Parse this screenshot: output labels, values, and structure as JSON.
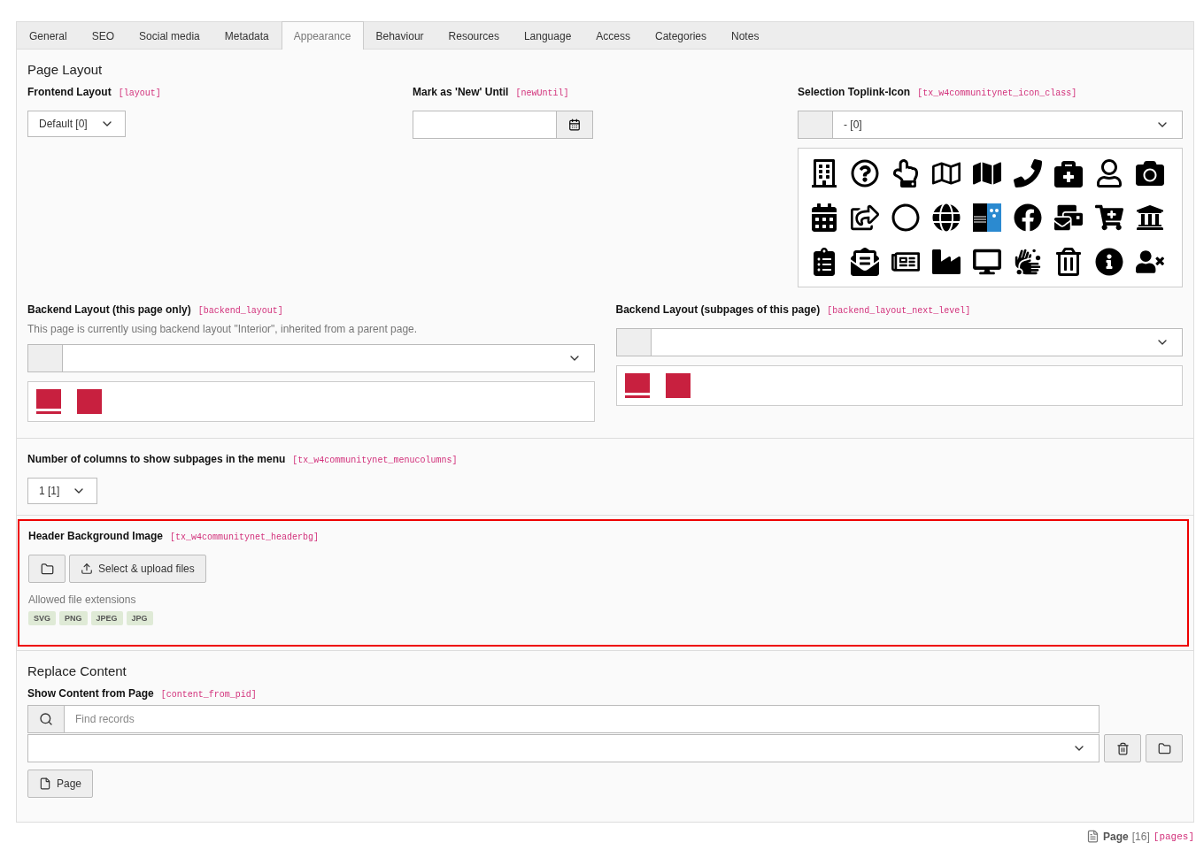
{
  "tabs": [
    {
      "label": "General",
      "selected": false
    },
    {
      "label": "SEO",
      "selected": false
    },
    {
      "label": "Social media",
      "selected": false
    },
    {
      "label": "Metadata",
      "selected": false
    },
    {
      "label": "Appearance",
      "selected": true
    },
    {
      "label": "Behaviour",
      "selected": false
    },
    {
      "label": "Resources",
      "selected": false
    },
    {
      "label": "Language",
      "selected": false
    },
    {
      "label": "Access",
      "selected": false
    },
    {
      "label": "Categories",
      "selected": false
    },
    {
      "label": "Notes",
      "selected": false
    }
  ],
  "page_layout": {
    "title": "Page Layout",
    "frontend_layout": {
      "label": "Frontend Layout",
      "field": "[layout]",
      "value": "Default [0]"
    },
    "new_until": {
      "label": "Mark as 'New' Until",
      "field": "[newUntil]"
    },
    "toplink_icon": {
      "label": "Selection Toplink-Icon",
      "field": "[tx_w4communitynet_icon_class]",
      "value": "- [0]"
    },
    "backend_layout": {
      "label": "Backend Layout (this page only)",
      "field": "[backend_layout]",
      "description": "This page is currently using backend layout \"Interior\", inherited from a parent page."
    },
    "backend_layout_next": {
      "label": "Backend Layout (subpages of this page)",
      "field": "[backend_layout_next_level]"
    }
  },
  "menu_columns": {
    "label": "Number of columns to show subpages in the menu",
    "field": "[tx_w4communitynet_menucolumns]",
    "value": "1 [1]"
  },
  "header_bg": {
    "label": "Header Background Image",
    "field": "[tx_w4communitynet_headerbg]",
    "upload_button": "Select & upload files",
    "allowed_label": "Allowed file extensions",
    "extensions": [
      "SVG",
      "PNG",
      "JPEG",
      "JPG"
    ]
  },
  "replace_content": {
    "title": "Replace Content",
    "label": "Show Content from Page",
    "field": "[content_from_pid]",
    "placeholder": "Find records",
    "page_button": "Page"
  },
  "footer": {
    "label": "Page",
    "id": "[16]",
    "table": "[pages]"
  }
}
